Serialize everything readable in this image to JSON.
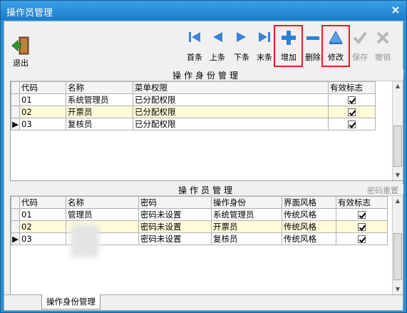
{
  "window": {
    "title": "操作员管理",
    "close": "×"
  },
  "toolbar": {
    "exit": "退出",
    "first": "首条",
    "prev": "上条",
    "next": "下条",
    "last": "末条",
    "add": "增加",
    "delete": "删除",
    "edit": "修改",
    "save": "保存",
    "cancel": "撤销"
  },
  "roles": {
    "title": "操作身份管理",
    "columns": [
      "代码",
      "名称",
      "菜单权限",
      "有效标志"
    ],
    "rows": [
      {
        "code": "01",
        "name": "系统管理员",
        "perm": "已分配权限",
        "valid": true
      },
      {
        "code": "02",
        "name": "开票员",
        "perm": "已分配权限",
        "valid": true
      },
      {
        "code": "03",
        "name": "复核员",
        "perm": "已分配权限",
        "valid": true
      }
    ]
  },
  "operators": {
    "title": "操作员管理",
    "reset": "密码重置",
    "columns": [
      "代码",
      "名称",
      "密码",
      "操作身份",
      "界面风格",
      "有效标志"
    ],
    "rows": [
      {
        "code": "01",
        "name": "管理员",
        "pwd": "密码未设置",
        "role": "系统管理员",
        "style": "传统风格",
        "valid": true
      },
      {
        "code": "02",
        "name": "",
        "pwd": "密码未设置",
        "role": "开票员",
        "style": "传统风格",
        "valid": true
      },
      {
        "code": "03",
        "name": "",
        "pwd": "密码未设置",
        "role": "复核员",
        "style": "传统风格",
        "valid": true
      }
    ]
  },
  "tabs": {
    "active": "操作身份管理"
  },
  "colors": {
    "title_bar": "#1c7dcc",
    "alt_row": "#fffbd9",
    "highlight": "#e02020"
  }
}
